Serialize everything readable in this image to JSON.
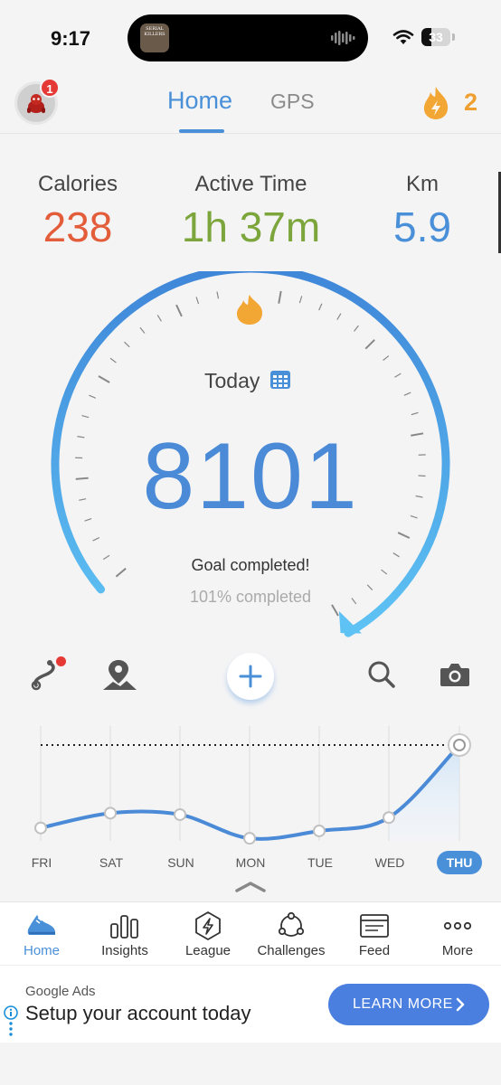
{
  "status_bar": {
    "time": "9:17",
    "battery": "33",
    "now_playing_art_text": "SERIAL KILLERS"
  },
  "header": {
    "notification_count": "1",
    "tabs": [
      {
        "label": "Home",
        "active": true
      },
      {
        "label": "GPS",
        "active": false
      }
    ],
    "streak_count": "2",
    "accent_color": "#4a90d9"
  },
  "stats": [
    {
      "label": "Calories",
      "value": "238",
      "color": "#e35d3a"
    },
    {
      "label": "Active Time",
      "value": "1h 37m",
      "color": "#7ca63c"
    },
    {
      "label": "Km",
      "value": "5.9",
      "color": "#4a90d9"
    }
  ],
  "gauge": {
    "title": "Today",
    "steps": "8101",
    "status": "Goal completed!",
    "percent_text": "101% completed",
    "percent_value": 101
  },
  "actions": [
    {
      "name": "route-icon",
      "has_dot": true
    },
    {
      "name": "map-pin-icon"
    },
    {
      "name": "add-icon"
    },
    {
      "name": "search-icon"
    },
    {
      "name": "camera-icon"
    }
  ],
  "weekly_chart": {
    "days": [
      "FRI",
      "SAT",
      "SUN",
      "MON",
      "TUE",
      "WED",
      "THU"
    ],
    "selected_day": "THU",
    "values": [
      2400,
      3400,
      3300,
      1700,
      2200,
      3100,
      8101
    ],
    "goal": 8000
  },
  "bottom_nav": [
    {
      "label": "Home",
      "icon": "shoe-icon",
      "active": true
    },
    {
      "label": "Insights",
      "icon": "bar-chart-icon",
      "active": false
    },
    {
      "label": "League",
      "icon": "league-icon",
      "active": false
    },
    {
      "label": "Challenges",
      "icon": "challenges-icon",
      "active": false
    },
    {
      "label": "Feed",
      "icon": "feed-icon",
      "active": false
    },
    {
      "label": "More",
      "icon": "more-icon",
      "active": false
    }
  ],
  "ad": {
    "source": "Google Ads",
    "headline": "Setup your account today",
    "cta": "LEARN MORE"
  }
}
